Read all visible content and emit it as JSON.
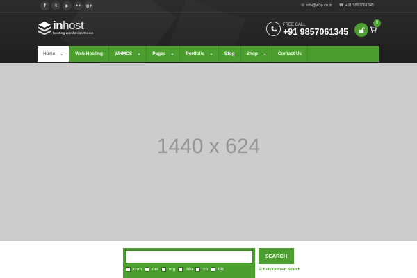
{
  "header": {
    "social": [
      {
        "icon": "facebook-icon",
        "glyph": "f"
      },
      {
        "icon": "twitter-icon",
        "glyph": "t"
      },
      {
        "icon": "youtube-icon",
        "glyph": "▶"
      },
      {
        "icon": "flickr-icon",
        "glyph": "••"
      },
      {
        "icon": "google-plus-icon",
        "glyph": "g+"
      }
    ],
    "email": "info@w3p.co.in",
    "phone_top": "+91 9857061345",
    "logo": {
      "bold": "in",
      "rest": "host",
      "tagline": "hosting wordpress theme"
    },
    "call": {
      "label": "FREE CALL",
      "number": "+91 9857061345"
    },
    "cart_count": "0"
  },
  "nav": {
    "items": [
      {
        "label": "Home",
        "dropdown": true,
        "active": true
      },
      {
        "label": "Web Hosting",
        "dropdown": false,
        "active": false
      },
      {
        "label": "WHMCS",
        "dropdown": true,
        "active": false
      },
      {
        "label": "Pages",
        "dropdown": true,
        "active": false
      },
      {
        "label": "Portfolio",
        "dropdown": true,
        "active": false
      },
      {
        "label": "Blog",
        "dropdown": false,
        "active": false
      },
      {
        "label": "Shop",
        "dropdown": true,
        "active": false
      },
      {
        "label": "Contact Us",
        "dropdown": false,
        "active": false
      }
    ]
  },
  "hero": {
    "placeholder_text": "1440 x 624"
  },
  "domain_search": {
    "input_value": "",
    "tlds": [
      ".com",
      ".net",
      ".org",
      ".info",
      ".co",
      ".biz"
    ],
    "search_label": "SEARCH",
    "bulk_label": "Bulk Domain Search"
  },
  "colors": {
    "accent": "#4c9f2f",
    "header_bg": "#262626",
    "hero_bg": "#cccccc"
  }
}
